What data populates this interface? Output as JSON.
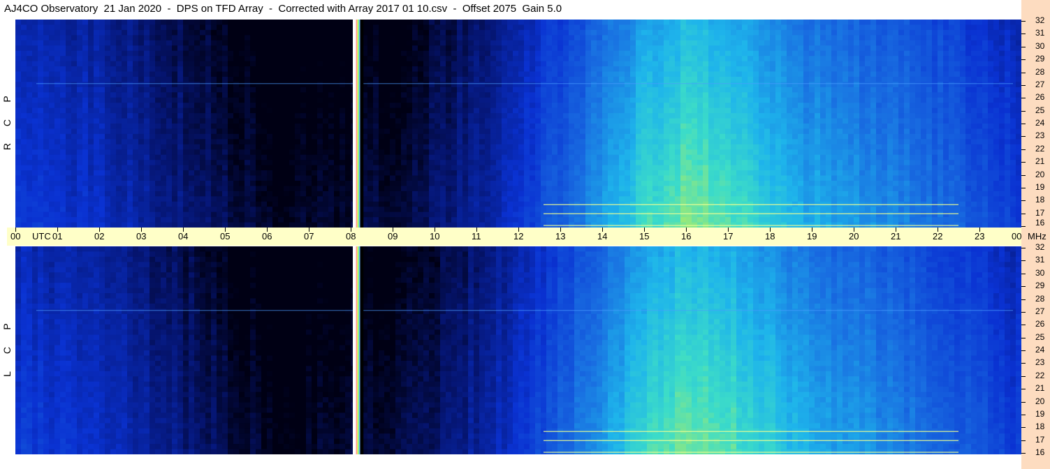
{
  "title": "AJ4CO Observatory  21 Jan 2020  -  DPS on TFD Array  -  Corrected with Array 2017 01 10.csv  -  Offset 2075  Gain 5.0",
  "colors": {
    "background_dark": "#000018",
    "background_blue": "#0a2fd6",
    "mid_blue": "#1e6ee0",
    "cyan": "#22b8e8",
    "green_yellow": "#c8f050",
    "time_bar": "#ffffc8",
    "freq_axis": "#fddcc0",
    "gap_white": "#ffffff"
  },
  "chart_data": {
    "type": "heatmap",
    "x_unit_label": "UTC",
    "y_unit_label": "MHz",
    "time_ticks": [
      "00",
      "01",
      "02",
      "03",
      "04",
      "05",
      "06",
      "07",
      "08",
      "09",
      "10",
      "11",
      "12",
      "13",
      "14",
      "15",
      "16",
      "17",
      "18",
      "19",
      "20",
      "21",
      "22",
      "23",
      "00"
    ],
    "xlim": [
      0,
      24
    ],
    "freq_ticks": [
      "32",
      "31",
      "30",
      "29",
      "28",
      "27",
      "26",
      "25",
      "24",
      "23",
      "22",
      "21",
      "20",
      "19",
      "18",
      "17",
      "16"
    ],
    "ylim": [
      16,
      32
    ],
    "panels": [
      {
        "name": "RCP",
        "letters": [
          "R",
          "C",
          "P"
        ]
      },
      {
        "name": "LCP",
        "letters": [
          "L",
          "C",
          "P"
        ]
      }
    ],
    "data_gap_hours": [
      8.05,
      8.3
    ],
    "intensity_profile": {
      "hours": [
        0,
        1,
        2,
        3,
        4,
        5,
        6,
        7,
        8,
        9,
        10,
        11,
        12,
        13,
        14,
        15,
        16,
        17,
        18,
        19,
        20,
        21,
        22,
        23,
        24
      ],
      "level": [
        0.32,
        0.3,
        0.27,
        0.22,
        0.15,
        0.08,
        0.03,
        0.02,
        0.05,
        0.06,
        0.12,
        0.2,
        0.3,
        0.42,
        0.55,
        0.7,
        0.78,
        0.74,
        0.66,
        0.58,
        0.55,
        0.5,
        0.45,
        0.38,
        0.32
      ]
    },
    "bright_bands_mhz": [
      17.1,
      17.8,
      16.2,
      27.1
    ]
  }
}
